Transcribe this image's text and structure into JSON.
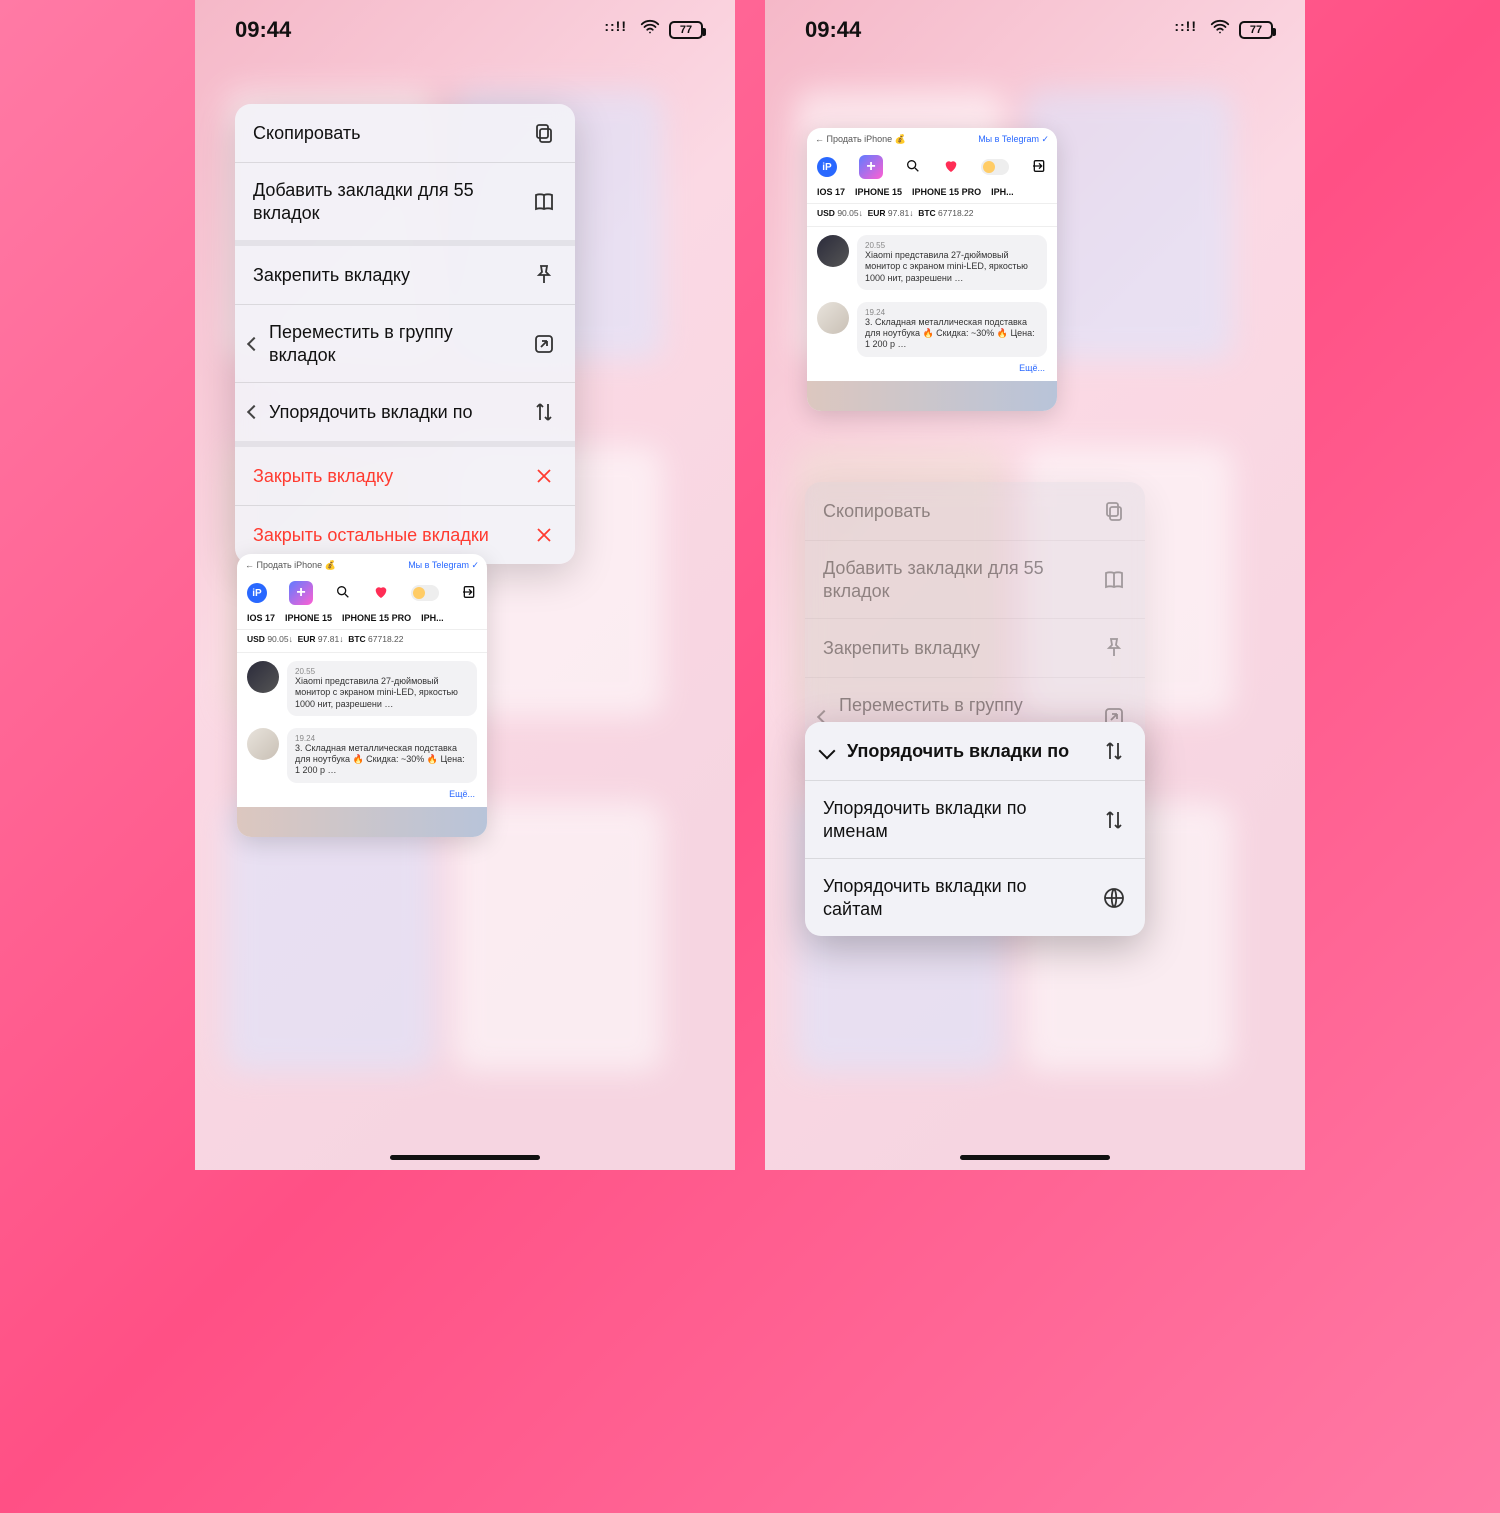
{
  "status": {
    "time": "09:44",
    "battery": "77"
  },
  "menu": {
    "copy": "Скопировать",
    "bookmarks": "Добавить закладки для 55 вкладок",
    "pin": "Закрепить вкладку",
    "move_group": "Переместить в группу вкладок",
    "sort": "Упорядочить вкладки по",
    "close_tab": "Закрыть вкладку",
    "close_other": "Закрыть остальные вкладки"
  },
  "submenu": {
    "head": "Упорядочить вкладки по",
    "by_name": "Упорядочить вкладки по именам",
    "by_site": "Упорядочить вкладки по сайтам"
  },
  "tab": {
    "back_link": "← Продать iPhone 💰",
    "telegram": "Мы в Telegram ✓",
    "tabs": [
      "IOS 17",
      "IPHONE 15",
      "IPHONE 15 PRO",
      "IPH..."
    ],
    "rates": {
      "usd_lbl": "USD",
      "usd": "90.05↓",
      "eur_lbl": "EUR",
      "eur": "97.81↓",
      "btc_lbl": "BTC",
      "btc": "67718.22"
    },
    "news1": {
      "time": "20.55",
      "txt": "Xiaomi представила 27-дюймовый монитор с экраном mini-LED, яркостью 1000 нит, разрешени …"
    },
    "news2": {
      "time": "19.24",
      "txt": "3. Складная металлическая подставка для ноутбука 🔥 Скидка: ~30% 🔥 Цена: 1 200 р …"
    },
    "more": "Ещё..."
  }
}
